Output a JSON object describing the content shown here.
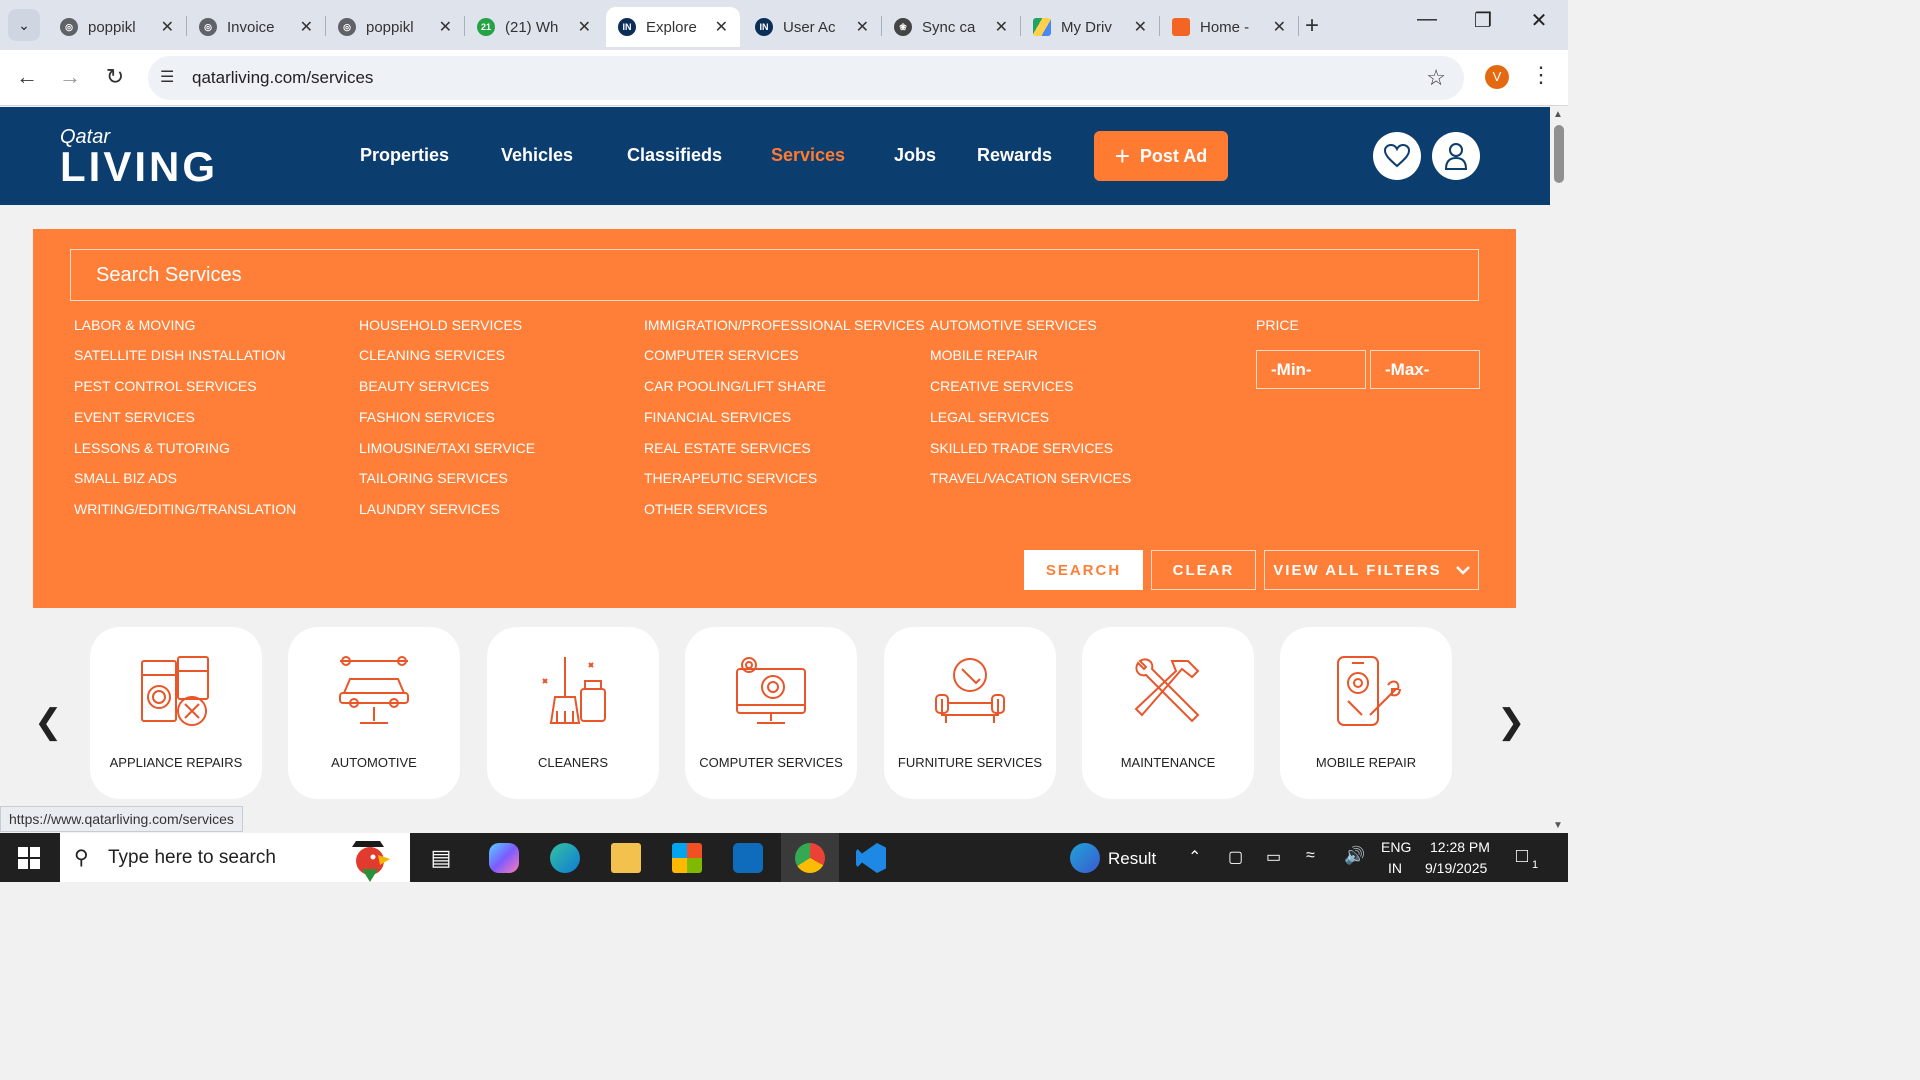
{
  "browser": {
    "tabs": [
      {
        "title": "poppikl",
        "icon": "globe-icon",
        "active": false
      },
      {
        "title": "Invoice",
        "icon": "globe-icon",
        "active": false
      },
      {
        "title": "poppikl",
        "icon": "globe-icon",
        "active": false
      },
      {
        "title": "(21) Wh",
        "icon": "whatsapp-icon",
        "badge": "21",
        "active": false
      },
      {
        "title": "Explore",
        "icon": "in-icon",
        "active": true
      },
      {
        "title": "User Ac",
        "icon": "in-icon",
        "active": false
      },
      {
        "title": "Sync ca",
        "icon": "openai-icon",
        "active": false
      },
      {
        "title": "My Driv",
        "icon": "drive-icon",
        "active": false
      },
      {
        "title": "Home -",
        "icon": "home-app-icon",
        "active": false
      }
    ],
    "url": "qatarliving.com/services",
    "profile_initial": "V",
    "status_url": "https://www.qatarliving.com/services"
  },
  "site": {
    "logo_top": "Qatar",
    "logo_main": "LIVING",
    "nav": [
      "Properties",
      "Vehicles",
      "Classifieds",
      "Services",
      "Jobs",
      "Rewards"
    ],
    "active_nav": "Services",
    "post_ad": "Post Ad"
  },
  "filters": {
    "search_placeholder": "Search Services",
    "columns": [
      [
        "LABOR & MOVING",
        "SATELLITE DISH INSTALLATION",
        "PEST CONTROL SERVICES",
        "EVENT SERVICES",
        "LESSONS & TUTORING",
        "SMALL BIZ ADS",
        "WRITING/EDITING/TRANSLATION"
      ],
      [
        "HOUSEHOLD SERVICES",
        "CLEANING SERVICES",
        "BEAUTY SERVICES",
        "FASHION SERVICES",
        "LIMOUSINE/TAXI SERVICE",
        "TAILORING SERVICES",
        "LAUNDRY SERVICES"
      ],
      [
        "IMMIGRATION/PROFESSIONAL SERVICES",
        "COMPUTER SERVICES",
        "CAR POOLING/LIFT SHARE",
        "FINANCIAL SERVICES",
        "REAL ESTATE SERVICES",
        "THERAPEUTIC SERVICES",
        "OTHER SERVICES"
      ],
      [
        "AUTOMOTIVE SERVICES",
        "MOBILE REPAIR",
        "CREATIVE SERVICES",
        "LEGAL SERVICES",
        "SKILLED TRADE SERVICES",
        "TRAVEL/VACATION SERVICES"
      ]
    ],
    "price_label": "PRICE",
    "min_placeholder": "-Min-",
    "max_placeholder": "-Max-",
    "search_btn": "SEARCH",
    "clear_btn": "CLEAR",
    "view_all_btn": "VIEW ALL FILTERS"
  },
  "categories": [
    {
      "label": "APPLIANCE REPAIRS",
      "icon": "appliance-icon"
    },
    {
      "label": "AUTOMOTIVE",
      "icon": "car-lift-icon"
    },
    {
      "label": "CLEANERS",
      "icon": "broom-icon"
    },
    {
      "label": "COMPUTER SERVICES",
      "icon": "computer-gear-icon"
    },
    {
      "label": "FURNITURE SERVICES",
      "icon": "sofa-wrench-icon"
    },
    {
      "label": "MAINTENANCE",
      "icon": "wrench-hammer-icon"
    },
    {
      "label": "MOBILE REPAIR",
      "icon": "phone-repair-icon"
    }
  ],
  "taskbar": {
    "search_placeholder": "Type here to search",
    "weather_label": "Result",
    "lang_top": "ENG",
    "lang_bottom": "IN",
    "time": "12:28 PM",
    "date": "9/19/2025",
    "notification_count": "1"
  },
  "colors": {
    "brand_navy": "#0b3d6e",
    "brand_orange": "#ff7f38"
  }
}
